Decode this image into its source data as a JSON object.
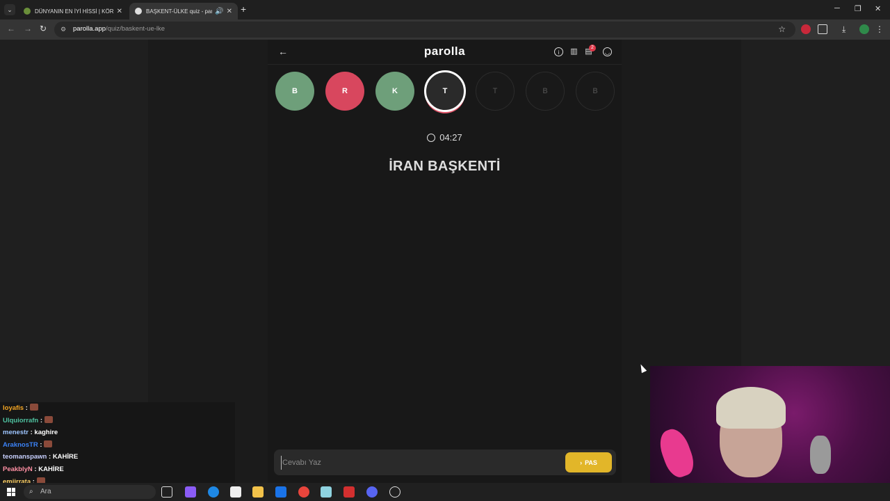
{
  "browser": {
    "tabs": [
      {
        "title": "DÜNYANIN EN İYİ HİSSİ | KÖR S",
        "active": false
      },
      {
        "title": "BAŞKENT-ÜLKE quiz - parol",
        "active": true
      }
    ],
    "url_host": "parolla.app",
    "url_path": "/quiz/baskent-ue-lke"
  },
  "app": {
    "logo": "parolla",
    "notification_count": "2",
    "letters": [
      {
        "letter": "B",
        "state": "correct"
      },
      {
        "letter": "R",
        "state": "wrong"
      },
      {
        "letter": "K",
        "state": "correct"
      },
      {
        "letter": "T",
        "state": "current"
      },
      {
        "letter": "T",
        "state": "pending"
      },
      {
        "letter": "B",
        "state": "pending"
      },
      {
        "letter": "B",
        "state": "pending"
      }
    ],
    "timer": "04:27",
    "question": "İRAN BAŞKENTİ",
    "answer_placeholder": "Cevabı Yaz",
    "pass_label": "PAS"
  },
  "chat": [
    {
      "user": "loyafis",
      "color": "#f5a623",
      "message": "",
      "emote": true
    },
    {
      "user": "Ulquiorrafn",
      "color": "#4fc3a1",
      "message": "",
      "emote": true
    },
    {
      "user": "menestr",
      "color": "#9ec5ff",
      "message": "kaghire",
      "emote": false
    },
    {
      "user": "AraknosTR",
      "color": "#3b82f6",
      "message": "",
      "emote": true
    },
    {
      "user": "teomanspawn",
      "color": "#c8d0ff",
      "message": "KAHİRE",
      "emote": false
    },
    {
      "user": "PeakblyN",
      "color": "#ff8fa3",
      "message": "KAHİRE",
      "emote": false
    },
    {
      "user": "emiirrata",
      "color": "#ffd166",
      "message": "",
      "emote": true
    }
  ],
  "taskbar": {
    "search_label": "Ara"
  }
}
